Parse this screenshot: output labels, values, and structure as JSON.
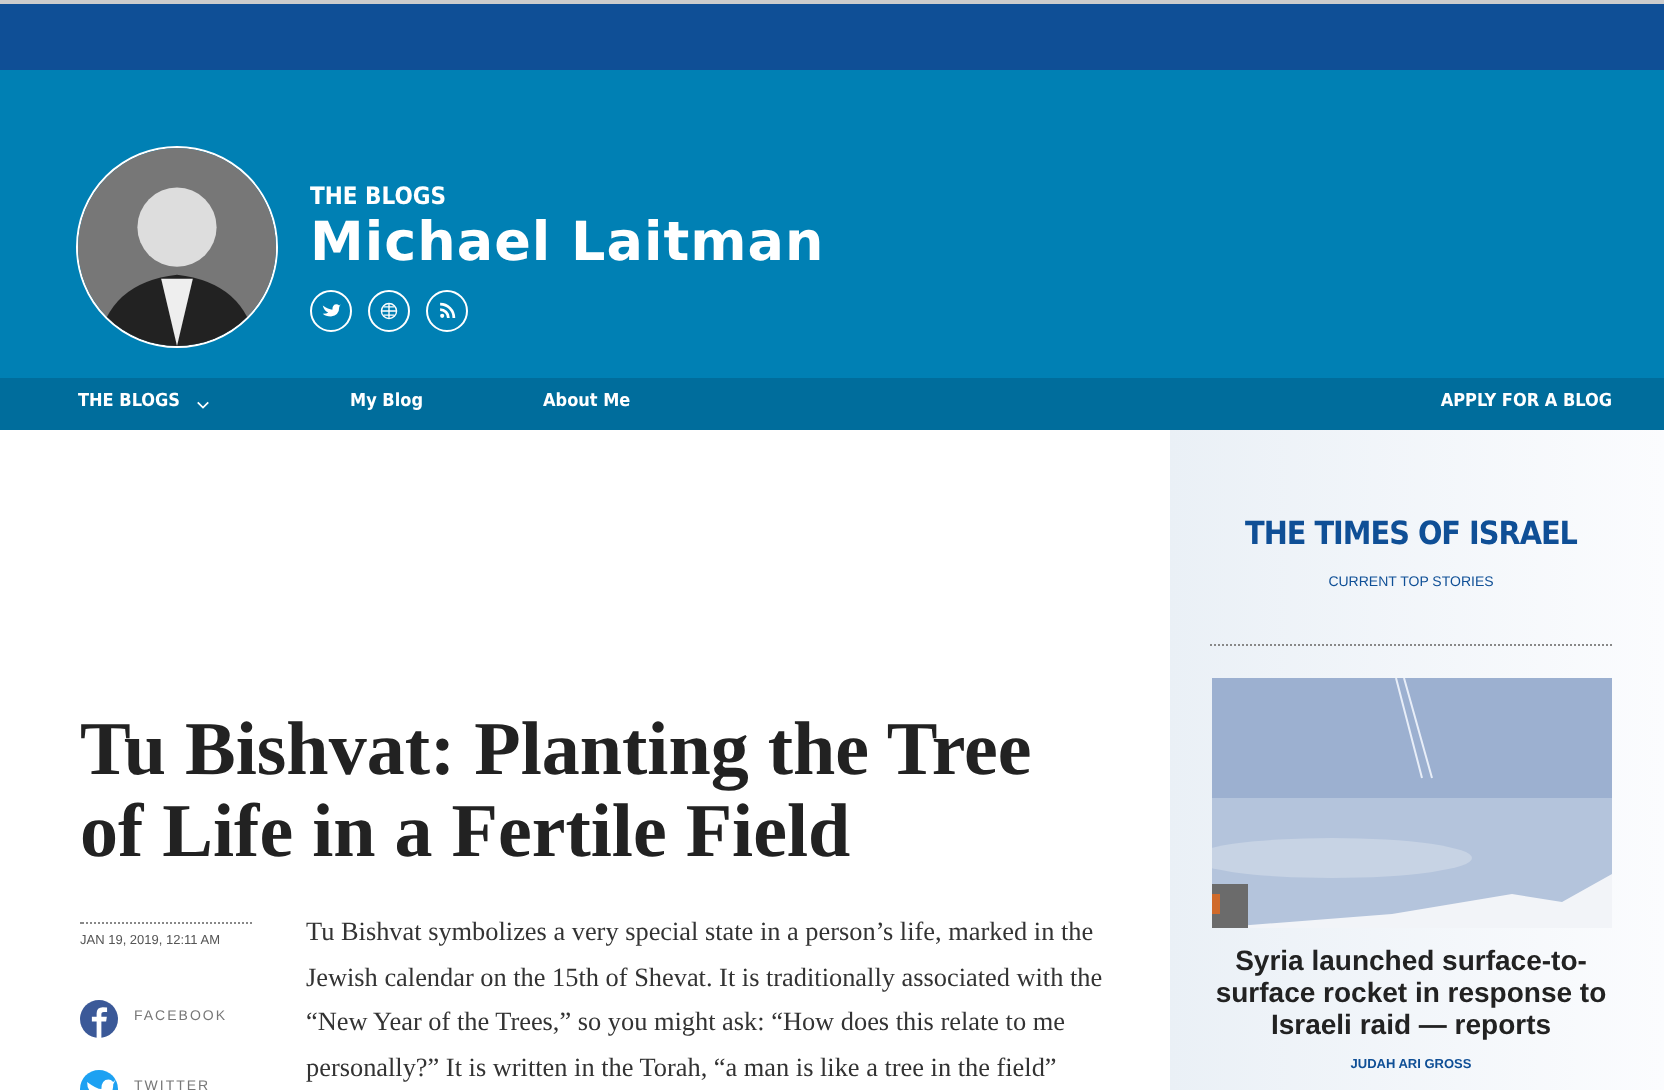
{
  "header": {
    "section": "THE BLOGS",
    "author": "Michael Laitman",
    "social": [
      {
        "kind": "twitter"
      },
      {
        "kind": "website"
      },
      {
        "kind": "rss"
      }
    ]
  },
  "nav": {
    "items": [
      {
        "label": "THE BLOGS",
        "kind": "dropdown"
      },
      {
        "label": "My Blog",
        "kind": "link"
      },
      {
        "label": "About Me",
        "kind": "link"
      }
    ],
    "cta": "APPLY FOR A BLOG"
  },
  "article": {
    "title": "Tu Bishvat: Planting the Tree of Life in a Fertile Field",
    "date": "JAN 19, 2019, 12:11 AM",
    "share": [
      {
        "kind": "facebook",
        "label": "FACEBOOK"
      },
      {
        "kind": "twitter",
        "label": "TWITTER"
      }
    ],
    "body": "Tu Bishvat symbolizes a very special state in a person’s life, marked in the Jewish calendar on the 15th of Shevat. It is traditionally associated with the “New Year of the Trees,” so you might ask: “How does this relate to me personally?” It is written in the Torah, “a man is like a tree in the field”"
  },
  "sidebar": {
    "brand": "THE TIMES OF ISRAEL",
    "subtitle": "CURRENT TOP STORIES",
    "story": {
      "headline": "Syria launched surface-to-surface rocket in response to Israeli raid — reports",
      "author": "JUDAH ARI GROSS"
    }
  }
}
